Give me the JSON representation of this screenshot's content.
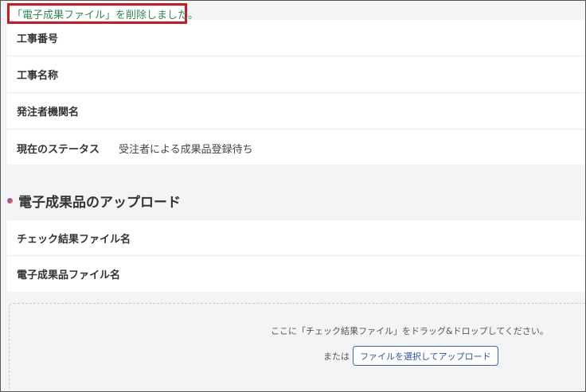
{
  "notice": {
    "message": "「電子成果ファイル」を削除しました。"
  },
  "project_info": {
    "rows": [
      {
        "label": "工事番号",
        "value": ""
      },
      {
        "label": "工事名称",
        "value": ""
      },
      {
        "label": "発注者機関名",
        "value": ""
      },
      {
        "label": "現在のステータス",
        "value": "受注者による成果品登録待ち"
      }
    ]
  },
  "upload_section": {
    "title": "電子成果品のアップロード",
    "rows": [
      {
        "label": "チェック結果ファイル名",
        "value": ""
      },
      {
        "label": "電子成果品ファイル名",
        "value": ""
      }
    ],
    "dropzone": {
      "instruction": "ここに「チェック結果ファイル」をドラッグ&ドロップしてください。",
      "or_text": "または",
      "button_label": "ファイルを選択してアップロード"
    }
  },
  "colors": {
    "notice_text": "#2f8a55",
    "notice_border": "#d0161e",
    "button_accent": "#3b66b8",
    "page_background": "#f3f4f6"
  }
}
